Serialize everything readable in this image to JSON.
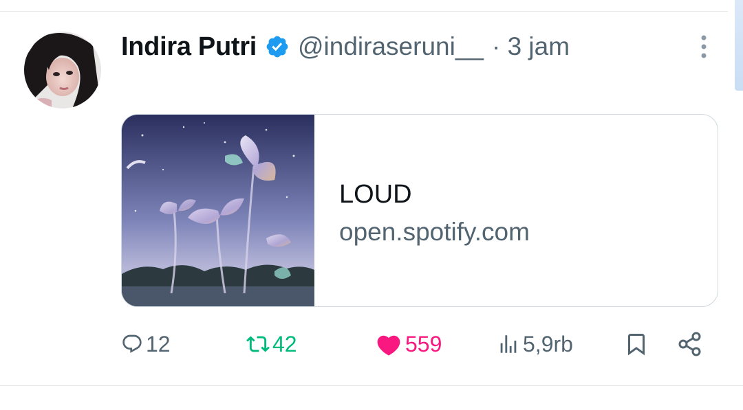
{
  "post": {
    "author": {
      "display_name": "Indira Putri",
      "handle": "@indiraseruni__",
      "verified_icon": "verified-badge-icon",
      "timestamp": "· 3 jam"
    },
    "link_card": {
      "title": "LOUD",
      "domain": "open.spotify.com"
    },
    "actions": {
      "replies": "12",
      "reposts": "42",
      "likes": "559",
      "views": "5,9rb"
    }
  },
  "colors": {
    "text_primary": "#0f1419",
    "text_secondary": "#536471",
    "verified": "#1d9bf0",
    "repost": "#00ba7c",
    "like": "#f91880",
    "border": "#cfd9de"
  },
  "icons": [
    "more-icon",
    "verified-badge-icon",
    "reply-icon",
    "repost-icon",
    "like-icon",
    "views-icon",
    "bookmark-icon",
    "share-icon"
  ]
}
